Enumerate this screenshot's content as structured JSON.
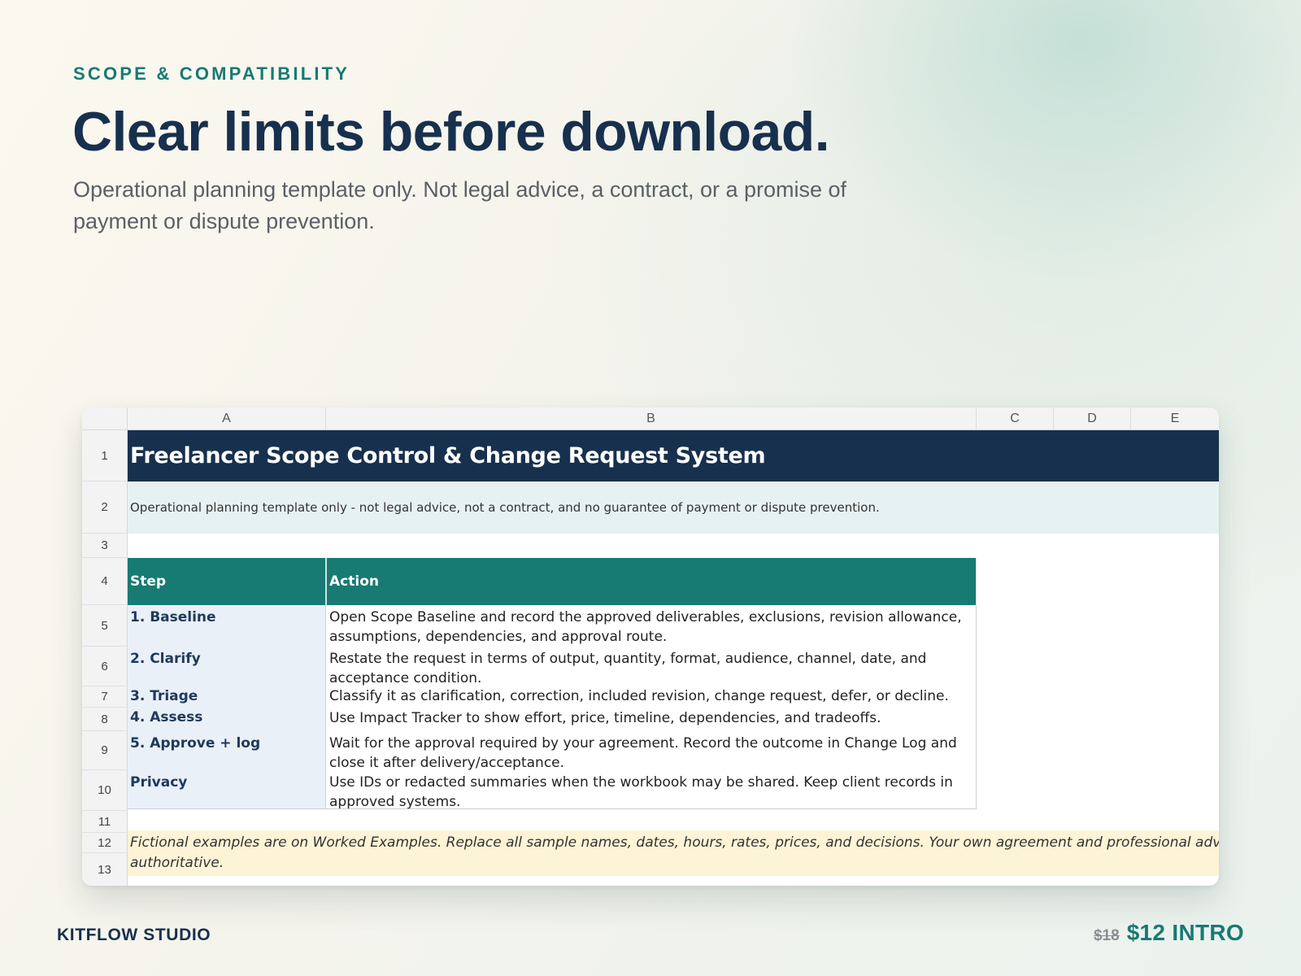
{
  "header": {
    "eyebrow": "SCOPE & COMPATIBILITY",
    "headline": "Clear limits before download.",
    "subtitle": "Operational planning template only. Not legal advice, a contract, or a promise of payment or dispute prevention."
  },
  "sheet": {
    "columns": [
      "A",
      "B",
      "C",
      "D",
      "E"
    ],
    "rows": [
      "1",
      "2",
      "3",
      "4",
      "5",
      "6",
      "7",
      "8",
      "9",
      "10",
      "11",
      "12",
      "13"
    ],
    "title": "Freelancer Scope Control & Change Request System",
    "note": "Operational planning template only - not legal advice, not a contract, and no guarantee of payment or dispute prevention.",
    "table_headers": [
      "Step",
      "Action"
    ],
    "steps": [
      {
        "step": "1. Baseline",
        "action": "Open Scope Baseline and record the approved deliverables, exclusions, revision allowance, assumptions, dependencies, and approval route."
      },
      {
        "step": "2. Clarify",
        "action": "Restate the request in terms of output, quantity, format, audience, channel, date, and acceptance condition."
      },
      {
        "step": "3. Triage",
        "action": "Classify it as clarification, correction, included revision, change request, defer, or decline."
      },
      {
        "step": "4. Assess",
        "action": "Use Impact Tracker to show effort, price, timeline, dependencies, and tradeoffs."
      },
      {
        "step": "5. Approve + log",
        "action": "Wait for the approval required by your agreement. Record the outcome in Change Log and close it after delivery/acceptance."
      },
      {
        "step": "Privacy",
        "action": "Use IDs or redacted summaries when the workbook may be shared. Keep client records in approved systems."
      }
    ],
    "footer_line1": "Fictional examples are on Worked Examples. Replace all sample names, dates, hours, rates, prices, and decisions. Your own agreement and professional advice r",
    "footer_line2": "authoritative."
  },
  "footer": {
    "brand": "KITFLOW STUDIO",
    "old_price": "$18",
    "new_price": "$12 INTRO"
  }
}
